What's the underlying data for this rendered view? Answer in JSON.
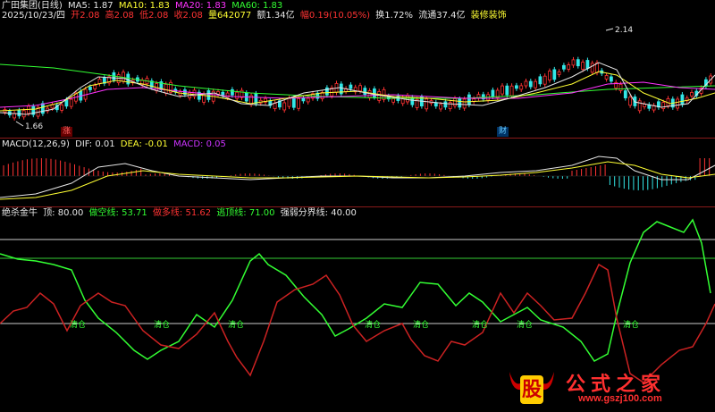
{
  "header": {
    "stock_name": "广田集团(日线)",
    "date_line": "2025/10/23/四",
    "open": "开2.08",
    "high": "高2.08",
    "low": "低2.08",
    "close": "收2.08",
    "volume": "量642077",
    "amount": "额1.34亿",
    "change": "幅0.19(10.05%)",
    "turnover": "换1.72%",
    "float": "流通37.4亿",
    "sector": "装修装饰",
    "ma5": "MA5: 1.87",
    "ma10": "MA10: 1.83",
    "ma20": "MA20: 1.83",
    "ma60": "MA60: 1.83"
  },
  "price_pane": {
    "high_mark": "2.14",
    "low_mark": "1.66",
    "badge_zhang": "涨",
    "badge_cai": "财",
    "colors": {
      "ma5": "#e6e6e6",
      "ma10": "#ffff33",
      "ma20": "#ff33ff",
      "ma60": "#33ff33",
      "up": "#ff3333",
      "down": "#33e6e6"
    }
  },
  "macd_pane": {
    "title": "MACD(12,26,9)",
    "dif": "DIF: 0.01",
    "dea": "DEA: -0.01",
    "macd": "MACD: 0.05"
  },
  "indicator_pane": {
    "name": "绝杀金牛",
    "top": "顶: 80.00",
    "short": "做空线: 53.71",
    "long": "做多线: 51.62",
    "escape": "逃顶线: 71.00",
    "divide": "强弱分界线: 40.00",
    "qingcang": "清仓",
    "qingcang_count": 7
  },
  "watermark": {
    "logo": "股",
    "site_name": "公式之家",
    "url": "www.gszj100.com"
  }
}
